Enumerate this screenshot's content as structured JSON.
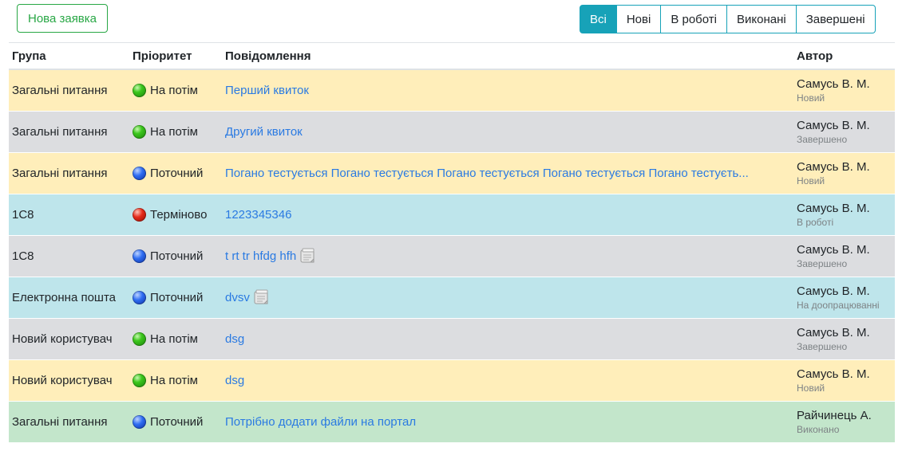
{
  "toolbar": {
    "new_request_label": "Нова заявка",
    "filters": [
      "Всі",
      "Нові",
      "В роботі",
      "Виконані",
      "Завершені"
    ],
    "active_filter": "Всі"
  },
  "table": {
    "headers": {
      "group": "Група",
      "priority": "Пріоритет",
      "message": "Повідомлення",
      "author": "Автор"
    },
    "rows": [
      {
        "group": "Загальні питання",
        "priority_icon": "green-ball-icon",
        "priority": "На потім",
        "message": "Перший квиток",
        "attachment": false,
        "author": "Самусь В. М.",
        "status": "Новий",
        "row_color": "#ffeeba"
      },
      {
        "group": "Загальні питання",
        "priority_icon": "green-ball-icon",
        "priority": "На потім",
        "message": "Другий квиток",
        "attachment": false,
        "author": "Самусь В. М.",
        "status": "Завершено",
        "row_color": "#dcdde0"
      },
      {
        "group": "Загальні питання",
        "priority_icon": "blue-ball-icon",
        "priority": "Поточний",
        "message": "Погано тестується Погано тестується Погано тестується Погано тестується Погано тестуєть...",
        "attachment": false,
        "author": "Самусь В. М.",
        "status": "Новий",
        "row_color": "#ffeeba"
      },
      {
        "group": "1С8",
        "priority_icon": "red-ball-icon",
        "priority": "Терміново",
        "message": "1223345346",
        "attachment": false,
        "author": "Самусь В. М.",
        "status": "В роботі",
        "row_color": "#bee5eb"
      },
      {
        "group": "1С8",
        "priority_icon": "blue-ball-icon",
        "priority": "Поточний",
        "message": "t rt tr hfdg hfh",
        "attachment": true,
        "author": "Самусь В. М.",
        "status": "Завершено",
        "row_color": "#dcdde0"
      },
      {
        "group": "Електронна пошта",
        "priority_icon": "blue-ball-icon",
        "priority": "Поточний",
        "message": "dvsv",
        "attachment": true,
        "author": "Самусь В. М.",
        "status": "На доопрацюванні",
        "row_color": "#bee5eb"
      },
      {
        "group": "Новий користувач",
        "priority_icon": "green-ball-icon",
        "priority": "На потім",
        "message": "dsg",
        "attachment": false,
        "author": "Самусь В. М.",
        "status": "Завершено",
        "row_color": "#dcdde0"
      },
      {
        "group": "Новий користувач",
        "priority_icon": "green-ball-icon",
        "priority": "На потім",
        "message": "dsg",
        "attachment": false,
        "author": "Самусь В. М.",
        "status": "Новий",
        "row_color": "#ffeeba"
      },
      {
        "group": "Загальні питання",
        "priority_icon": "blue-ball-icon",
        "priority": "Поточний",
        "message": "Потрібно додати файли на портал",
        "attachment": false,
        "author": "Райчинець А.",
        "status": "Виконано",
        "row_color": "#c3e6cb"
      }
    ]
  },
  "colors": {
    "accent_info": "#17a2b8",
    "accent_success": "#28a745",
    "link": "#2a7ae2"
  }
}
